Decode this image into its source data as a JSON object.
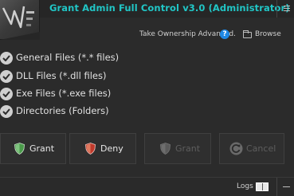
{
  "window": {
    "title": "Grant Admin Full Control v3.0 (Administrator)",
    "title_color": "#21c6c6",
    "logo_icon": "app-logo-icon",
    "menu_icon": "hamburger-menu-icon"
  },
  "top_actions": {
    "ownership_label": "Take Ownership Advanced.",
    "help_icon": "?",
    "browse_label": "Browse"
  },
  "options": [
    {
      "label": "General Files (*.* files)",
      "checked": true
    },
    {
      "label": "DLL Files (*.dll files)",
      "checked": true
    },
    {
      "label": "Exe Files (*.exe files)",
      "checked": true
    },
    {
      "label": "Directories (Folders)",
      "checked": true
    }
  ],
  "buttons": {
    "grant": {
      "label": "Grant",
      "enabled": true,
      "icon": "green-shield-icon"
    },
    "deny": {
      "label": "Deny",
      "enabled": true,
      "icon": "red-shield-icon"
    },
    "grant_disabled": {
      "label": "Grant",
      "enabled": false,
      "icon": "gray-shield-icon"
    },
    "cancel": {
      "label": "Cancel",
      "enabled": false,
      "icon": "refresh-icon"
    }
  },
  "status": {
    "logs_label": "Logs",
    "logs_icon": "logs-toggle-icon"
  },
  "colors": {
    "background": "#2b2b2b",
    "accent": "#21c6c6",
    "help_blue": "#1e88e5",
    "shield_green": "#4a9a4a",
    "shield_red": "#c0392b"
  }
}
